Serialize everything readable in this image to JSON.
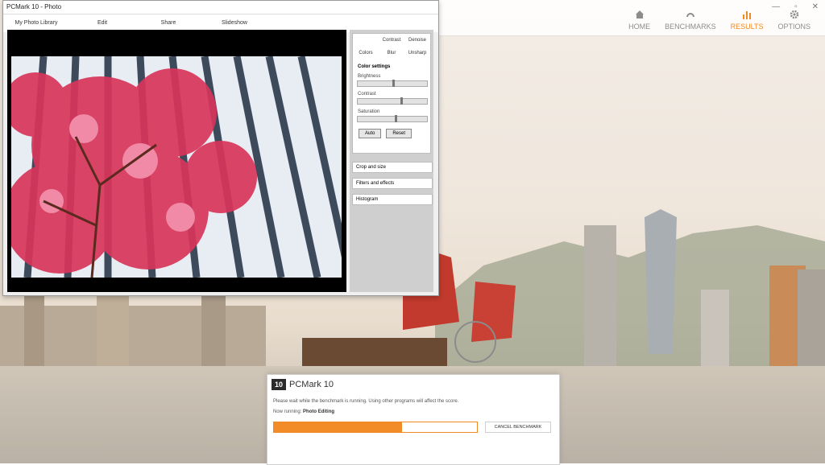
{
  "photo_window": {
    "title": "PCMark 10 - Photo",
    "menu": [
      "My Photo Library",
      "Edit",
      "Share",
      "Slideshow"
    ]
  },
  "editor_panel": {
    "tabs_row1": [
      "Contrast",
      "Denoise"
    ],
    "tabs_row2": [
      "Colors",
      "Blur",
      "Unsharp"
    ],
    "section_title": "Color settings",
    "sliders": [
      {
        "label": "Brightness",
        "value": 0.5
      },
      {
        "label": "Contrast",
        "value": 0.62
      },
      {
        "label": "Saturation",
        "value": 0.53
      }
    ],
    "buttons": {
      "auto": "Auto",
      "reset": "Reset"
    },
    "panels": [
      "Crop and size",
      "Filters and effects",
      "Histogram"
    ]
  },
  "app_nav": {
    "items": [
      {
        "label": "HOME",
        "icon": "home-icon"
      },
      {
        "label": "BENCHMARKS",
        "icon": "gauge-icon"
      },
      {
        "label": "RESULTS",
        "icon": "bar-chart-icon",
        "active": true
      },
      {
        "label": "OPTIONS",
        "icon": "gear-icon"
      }
    ]
  },
  "window_controls": {
    "minimize": "—",
    "maximize": "▫",
    "close": "✕"
  },
  "dialog": {
    "logo": "10",
    "title": "PCMark 10",
    "message": "Please wait while the benchmark is running. Using other programs will affect the score.",
    "running_label": "Now running:",
    "running_value": "Photo Editing",
    "progress": 0.63,
    "cancel_label": "CANCEL BENCHMARK"
  },
  "colors": {
    "accent": "#f28c28",
    "active_nav": "#f08a24"
  }
}
